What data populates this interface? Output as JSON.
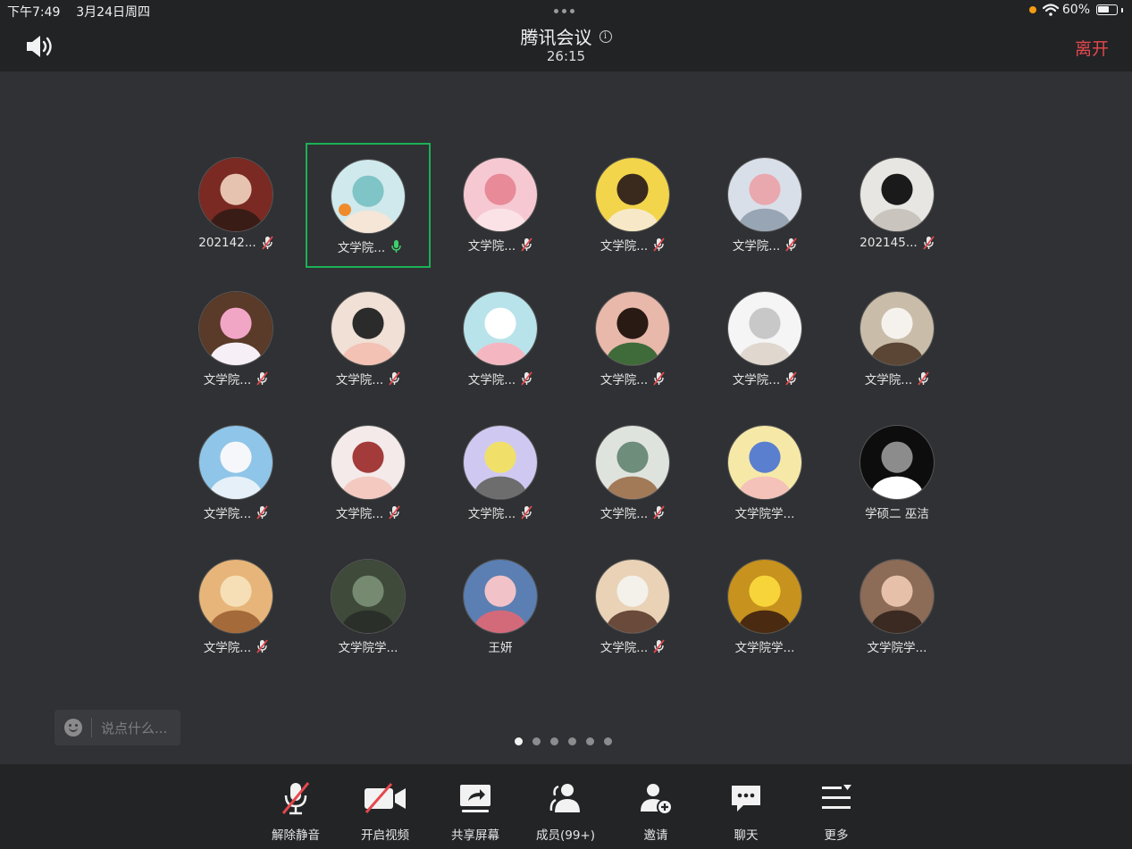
{
  "status_bar": {
    "time": "下午7:49",
    "date": "3月24日周四",
    "battery": "60%"
  },
  "meeting": {
    "title": "腾讯会议",
    "timer": "26:15",
    "leave_label": "离开"
  },
  "participants": [
    {
      "name": "202142...",
      "muted": true
    },
    {
      "name": "文学院...",
      "muted": false,
      "speaking": true,
      "host": true
    },
    {
      "name": "文学院...",
      "muted": true
    },
    {
      "name": "文学院...",
      "muted": true
    },
    {
      "name": "文学院...",
      "muted": true
    },
    {
      "name": "202145...",
      "muted": true
    },
    {
      "name": "文学院...",
      "muted": true
    },
    {
      "name": "文学院...",
      "muted": true
    },
    {
      "name": "文学院...",
      "muted": true
    },
    {
      "name": "文学院...",
      "muted": true
    },
    {
      "name": "文学院...",
      "muted": true
    },
    {
      "name": "文学院...",
      "muted": true
    },
    {
      "name": "文学院...",
      "muted": true
    },
    {
      "name": "文学院...",
      "muted": true
    },
    {
      "name": "文学院...",
      "muted": true
    },
    {
      "name": "文学院...",
      "muted": true
    },
    {
      "name": "文学院学...",
      "muted": null
    },
    {
      "name": "学硕二 巫洁",
      "muted": null
    },
    {
      "name": "文学院...",
      "muted": true
    },
    {
      "name": "文学院学...",
      "muted": null
    },
    {
      "name": "王妍",
      "muted": null
    },
    {
      "name": "文学院...",
      "muted": true
    },
    {
      "name": "文学院学...",
      "muted": null
    },
    {
      "name": "文学院学...",
      "muted": null
    }
  ],
  "chat": {
    "placeholder": "说点什么..."
  },
  "pagination": {
    "pages": 6,
    "current": 1
  },
  "toolbar": {
    "unmute": "解除静音",
    "start_video": "开启视频",
    "share_screen": "共享屏幕",
    "members": "成员(99+)",
    "invite": "邀请",
    "chat": "聊天",
    "more": "更多"
  },
  "colors": {
    "accent_green": "#1bb155",
    "leave_red": "#e5484d",
    "muted_red": "#e5484d"
  }
}
